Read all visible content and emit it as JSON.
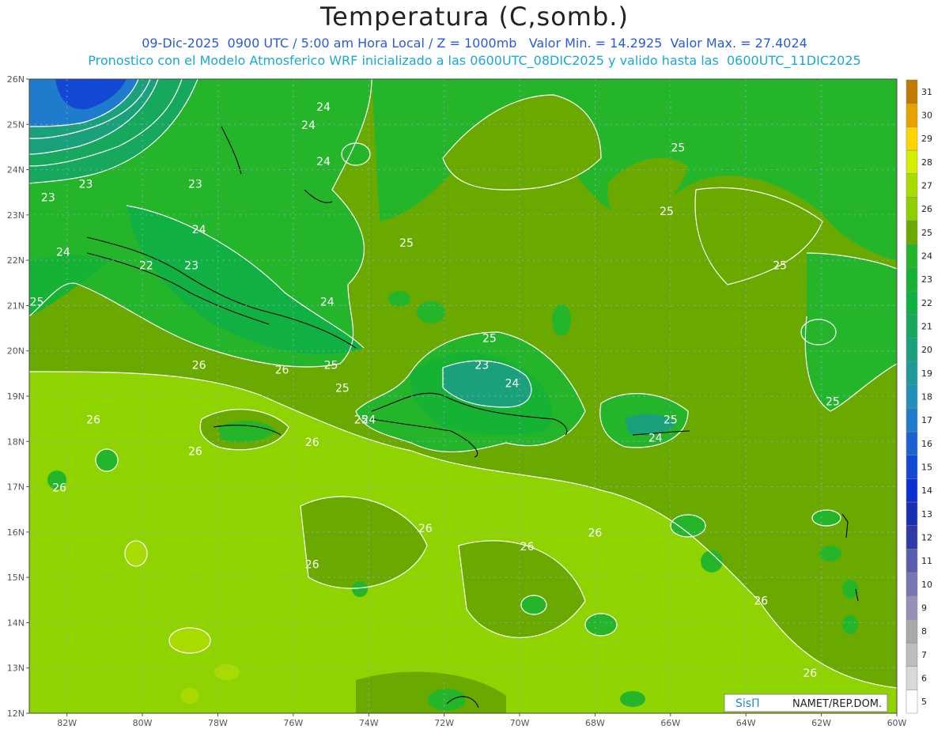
{
  "title": "Temperatura (C,somb.)",
  "subtitle_line1": "09-Dic-2025  0900 UTC / 5:00 am Hora Local / Z = 1000mb   Valor Min. = 14.2925  Valor Max. = 27.4024",
  "subtitle_line2": "Pronostico con el Modelo Atmosferico WRF inicializado a las 0600UTC_08DIC2025 y valido hasta las  0600UTC_11DIC2025",
  "lat_labels": [
    "26N",
    "25N",
    "24N",
    "23N",
    "22N",
    "21N",
    "20N",
    "19N",
    "18N",
    "17N",
    "16N",
    "15N",
    "14N",
    "13N",
    "12N"
  ],
  "lon_labels": [
    "82W",
    "80W",
    "78W",
    "76W",
    "74W",
    "72W",
    "70W",
    "68W",
    "66W",
    "64W",
    "62W",
    "60W"
  ],
  "colorbar": {
    "levels": [
      "5",
      "6",
      "7",
      "8",
      "9",
      "10",
      "11",
      "12",
      "13",
      "14",
      "15",
      "16",
      "17",
      "18",
      "19",
      "20",
      "21",
      "22",
      "23",
      "24",
      "25",
      "26",
      "27",
      "28",
      "29",
      "30",
      "31"
    ],
    "colors": [
      "#ffffff",
      "#d9d9d9",
      "#bdbdbd",
      "#a9a9a9",
      "#9a8fb8",
      "#7a76b3",
      "#5a5cb0",
      "#2e3aa8",
      "#1630b0",
      "#0b2fd0",
      "#1248d4",
      "#1a62d0",
      "#1f7ccc",
      "#2290b8",
      "#1e9a99",
      "#1aa07a",
      "#16a85c",
      "#10b043",
      "#16b233",
      "#24b52a",
      "#6aaa00",
      "#8fcf00",
      "#a8dc00",
      "#d4f000",
      "#ffd400",
      "#e8a200",
      "#c07a00"
    ]
  },
  "contour_labels": [
    "23",
    "23",
    "23",
    "24",
    "24",
    "22",
    "23",
    "24",
    "24",
    "24",
    "25",
    "25",
    "25",
    "25",
    "25",
    "25",
    "25",
    "25",
    "24",
    "26",
    "26",
    "26",
    "26",
    "26",
    "26",
    "26",
    "26",
    "26",
    "26",
    "23",
    "24",
    "25",
    "24",
    "25",
    "24",
    "25",
    "26",
    "26"
  ],
  "logo": {
    "brand": "SisΠ",
    "text": "NAMET/REP.DOM."
  },
  "chart_data": {
    "type": "heatmap",
    "title": "Temperatura (C,somb.)",
    "variable": "Temperature at 1000 mb (shaded, C)",
    "valid_time": "09-Dic-2025 0900 UTC",
    "value_min": 14.2925,
    "value_max": 27.4024,
    "lat_range": [
      12,
      26
    ],
    "lon_range": [
      -83,
      -60
    ],
    "colorbar_levels": [
      5,
      6,
      7,
      8,
      9,
      10,
      11,
      12,
      13,
      14,
      15,
      16,
      17,
      18,
      19,
      20,
      21,
      22,
      23,
      24,
      25,
      26,
      27,
      28,
      29,
      30,
      31
    ]
  },
  "colors": {
    "sea_warm": "#8fd400",
    "sea_mid": "#6aaa00",
    "land_cool": "#17a63c",
    "coldest": "#0b3fc4",
    "coastline": "#000000"
  }
}
